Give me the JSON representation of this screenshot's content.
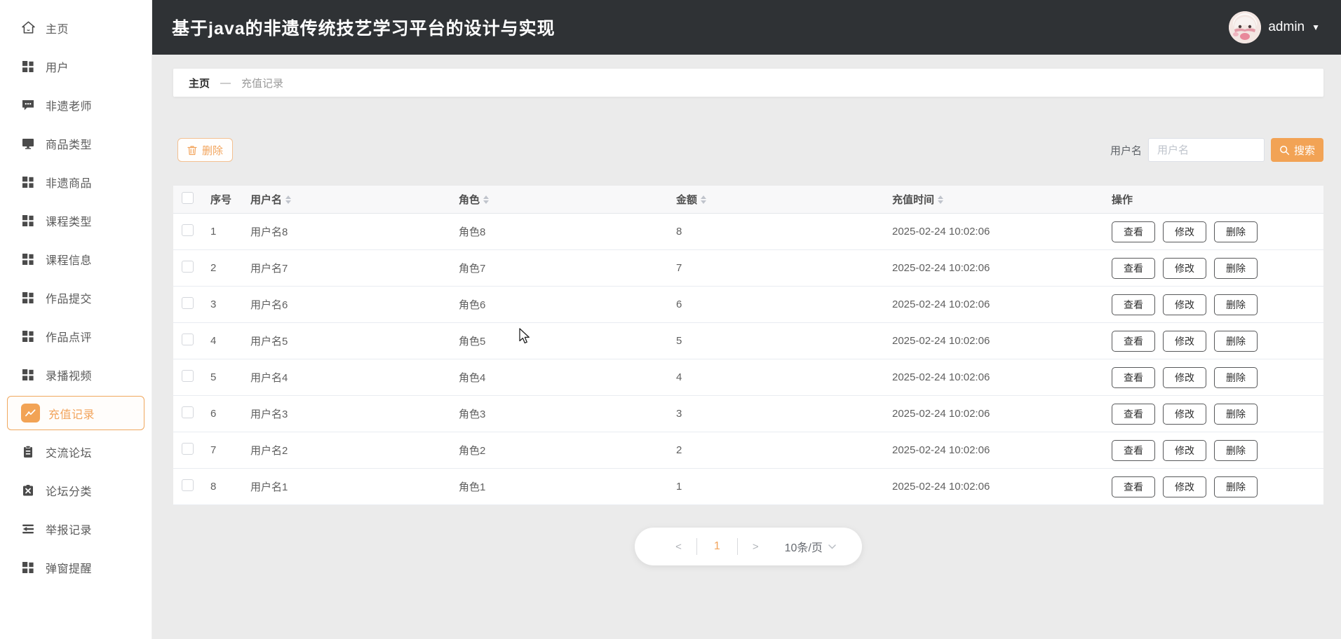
{
  "header": {
    "title": "基于java的非遗传统技艺学习平台的设计与实现",
    "user": "admin",
    "caret": "▼"
  },
  "sidebar": {
    "items": [
      {
        "label": "主页",
        "icon": "home-icon"
      },
      {
        "label": "用户",
        "icon": "grid-icon"
      },
      {
        "label": "非遗老师",
        "icon": "chat-icon"
      },
      {
        "label": "商品类型",
        "icon": "monitor-icon"
      },
      {
        "label": "非遗商品",
        "icon": "grid-icon"
      },
      {
        "label": "课程类型",
        "icon": "grid-icon"
      },
      {
        "label": "课程信息",
        "icon": "grid-icon"
      },
      {
        "label": "作品提交",
        "icon": "grid-icon"
      },
      {
        "label": "作品点评",
        "icon": "grid-icon"
      },
      {
        "label": "录播视频",
        "icon": "grid-icon"
      },
      {
        "label": "充值记录",
        "icon": "trend-icon",
        "active": true
      },
      {
        "label": "交流论坛",
        "icon": "clipboard-icon"
      },
      {
        "label": "论坛分类",
        "icon": "clipboard-x-icon"
      },
      {
        "label": "举报记录",
        "icon": "report-icon"
      },
      {
        "label": "弹窗提醒",
        "icon": "grid-icon"
      }
    ]
  },
  "breadcrumb": {
    "home": "主页",
    "separator": "—",
    "current": "充值记录"
  },
  "toolbar": {
    "delete_label": "删除",
    "filter_label": "用户名",
    "filter_placeholder": "用户名",
    "search_label": "搜索"
  },
  "table": {
    "headers": [
      "序号",
      "用户名",
      "角色",
      "金额",
      "充值时间",
      "操作"
    ],
    "actions": [
      "查看",
      "修改",
      "删除"
    ],
    "rows": [
      {
        "index": "1",
        "username": "用户名8",
        "role": "角色8",
        "amount": "8",
        "time": "2025-02-24 10:02:06"
      },
      {
        "index": "2",
        "username": "用户名7",
        "role": "角色7",
        "amount": "7",
        "time": "2025-02-24 10:02:06"
      },
      {
        "index": "3",
        "username": "用户名6",
        "role": "角色6",
        "amount": "6",
        "time": "2025-02-24 10:02:06"
      },
      {
        "index": "4",
        "username": "用户名5",
        "role": "角色5",
        "amount": "5",
        "time": "2025-02-24 10:02:06"
      },
      {
        "index": "5",
        "username": "用户名4",
        "role": "角色4",
        "amount": "4",
        "time": "2025-02-24 10:02:06"
      },
      {
        "index": "6",
        "username": "用户名3",
        "role": "角色3",
        "amount": "3",
        "time": "2025-02-24 10:02:06"
      },
      {
        "index": "7",
        "username": "用户名2",
        "role": "角色2",
        "amount": "2",
        "time": "2025-02-24 10:02:06"
      },
      {
        "index": "8",
        "username": "用户名1",
        "role": "角色1",
        "amount": "1",
        "time": "2025-02-24 10:02:06"
      }
    ]
  },
  "pagination": {
    "prev": "<",
    "current_page": "1",
    "next": ">",
    "page_size": "10条/页"
  },
  "colors": {
    "accent": "#f2a45c",
    "accent_solid": "#f2a355",
    "header_bg": "#2f3235",
    "page_bg": "#ebebeb"
  }
}
